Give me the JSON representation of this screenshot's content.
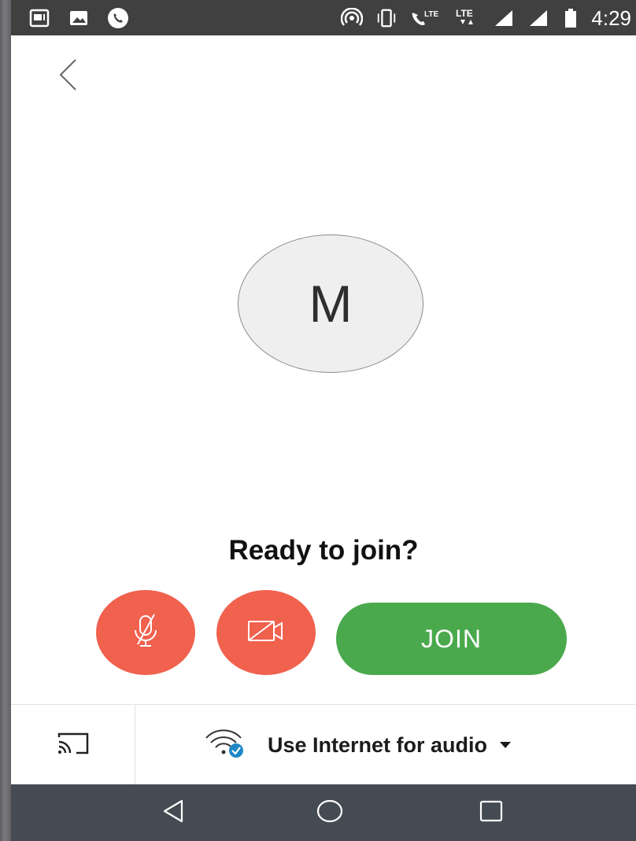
{
  "status_bar": {
    "time": "4:29",
    "left_icons": [
      "screenshot-icon",
      "image-icon",
      "phone-call-icon"
    ],
    "right_icons": [
      "hotspot-icon",
      "vibrate-icon",
      "volte-call-icon",
      "lte-data-icon",
      "signal-icon",
      "signal-icon",
      "battery-icon"
    ],
    "network_label_1": "LTE",
    "network_label_2": "LTE"
  },
  "avatar": {
    "initial": "M"
  },
  "prompt": {
    "title": "Ready to join?"
  },
  "controls": {
    "mic_state": "muted",
    "camera_state": "off",
    "join_label": "JOIN"
  },
  "bottom_bar": {
    "audio_option": "Use Internet for audio"
  },
  "colors": {
    "danger": "#f0614e",
    "join": "#4aa94c",
    "status_bar": "#404040",
    "nav_bar": "#444b52",
    "accent_check": "#1e88c7"
  }
}
